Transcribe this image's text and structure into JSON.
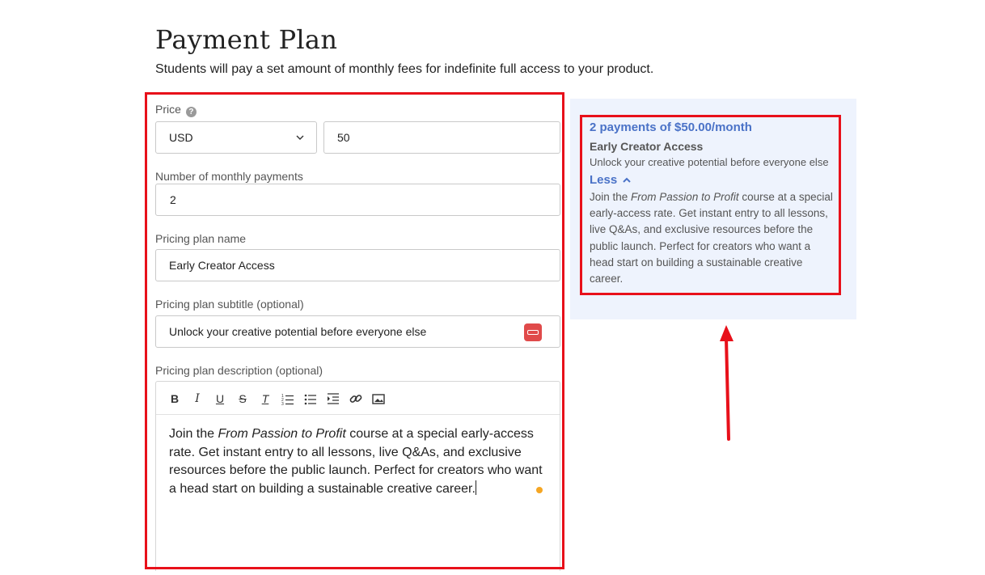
{
  "page": {
    "title": "Payment Plan",
    "subtitle": "Students will pay a set amount of monthly fees for indefinite full access to your product."
  },
  "form": {
    "price_label": "Price",
    "help_icon": "?",
    "currency_value": "USD",
    "price_value": "50",
    "payments_label": "Number of monthly payments",
    "payments_value": "2",
    "plan_name_label": "Pricing plan name",
    "plan_name_value": "Early Creator Access",
    "subtitle_label": "Pricing plan subtitle (optional)",
    "subtitle_value": "Unlock your creative potential before everyone else",
    "description_label": "Pricing plan description (optional)",
    "description": {
      "before": "Join the ",
      "emphasis": "From Passion to Profit",
      "after": " course at a special early-access rate. Get instant entry to all lessons, live Q&As, and exclusive resources before the public launch. Perfect for creators who want a head start on building a sustainable creative career."
    },
    "toolbar": {
      "bold": "B",
      "italic": "I",
      "underline": "U",
      "strike": "S",
      "clear": "T"
    }
  },
  "preview": {
    "title": "2 payments of $50.00/month",
    "name": "Early Creator Access",
    "subtitle": "Unlock your creative potential before everyone else",
    "toggle_label": "Less",
    "desc_before": "Join the ",
    "desc_emphasis": "From Passion to Profit",
    "desc_after": " course at a special early-access rate. Get instant entry to all lessons, live Q&As, and exclusive resources before the public launch. Perfect for creators who want a head start on building a sustainable creative career."
  },
  "colors": {
    "highlight": "#e8101a",
    "accent": "#4a72c7",
    "preview_bg": "#eef3fd"
  }
}
